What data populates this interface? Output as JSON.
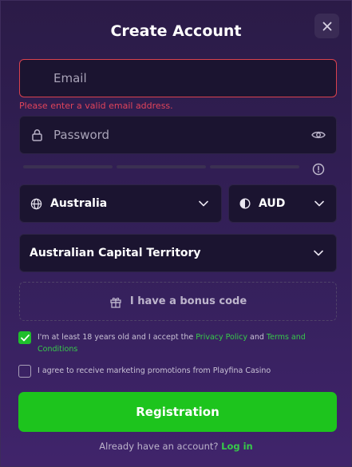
{
  "modal": {
    "title": "Create Account"
  },
  "email": {
    "placeholder": "Email",
    "value": "",
    "error": "Please enter a valid email address."
  },
  "password": {
    "placeholder": "Password",
    "value": ""
  },
  "country": {
    "selected": "Australia"
  },
  "currency": {
    "selected": "AUD"
  },
  "region": {
    "selected": "Australian Capital Territory"
  },
  "bonus": {
    "label": "I have a bonus code"
  },
  "terms": {
    "checked": true,
    "prefix": "I'm at least 18 years old and I accept the ",
    "privacy_link": "Privacy Policy",
    "middle": " and ",
    "terms_link": "Terms and Conditions"
  },
  "marketing": {
    "checked": false,
    "label": "I agree to receive marketing promotions from Playfina Casino"
  },
  "register": {
    "label": "Registration"
  },
  "login": {
    "prompt": "Already have an account?",
    "link": "Log in"
  },
  "colors": {
    "accent_green": "#1dc41d",
    "error_red": "#e0445a",
    "link_green": "#37c94a"
  }
}
